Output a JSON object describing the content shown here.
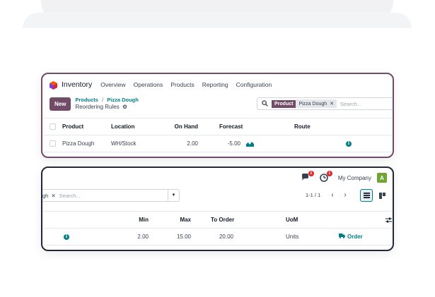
{
  "navbar": {
    "app_name": "Inventory",
    "menu": [
      "Overview",
      "Operations",
      "Products",
      "Reporting",
      "Configuration"
    ]
  },
  "control_panel": {
    "new_label": "New",
    "breadcrumb_parent": "Products",
    "breadcrumb_separator": "/",
    "breadcrumb_item": "Pizza Dough",
    "current_view": "Reordering Rules"
  },
  "search": {
    "facet_label": "Product",
    "facet_value": "Pizza Dough",
    "facet_value_tail": "gh",
    "placeholder": "Search..."
  },
  "systray": {
    "messages_count": "2",
    "activities_count": "1",
    "company": "My Company",
    "avatar_letter": "A"
  },
  "pager": {
    "text": "1-1 / 1"
  },
  "table": {
    "columns": [
      "Product",
      "Location",
      "On Hand",
      "Forecast",
      "Route",
      "Min",
      "Max",
      "To Order",
      "UoM"
    ],
    "rows": [
      {
        "product": "Pizza Dough",
        "location": "WH/Stock",
        "on_hand": "2.00",
        "forecast": "-5.00",
        "min": "2.00",
        "max": "15.00",
        "to_order": "20.00",
        "uom": "Units",
        "action": "Order"
      }
    ]
  },
  "colors": {
    "brand": "#714b67",
    "accent": "#017e84",
    "badge": "#dc2626",
    "avatar": "#6ea632"
  }
}
